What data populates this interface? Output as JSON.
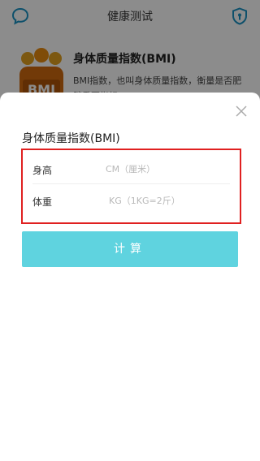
{
  "header": {
    "title": "健康测试",
    "left_icon": "chat-bubble-icon",
    "right_icon": "shield-icon",
    "accent": "#1a93c4"
  },
  "background_card": {
    "title": "身体质量指数(BMI)",
    "description": "BMI指数，也叫身体质量指数，衡量是否肥胖重要指标",
    "logo_text": "BMI"
  },
  "sheet": {
    "title": "身体质量指数(BMI)",
    "close_icon": "close-icon",
    "fields": [
      {
        "label": "身高",
        "value": "",
        "placeholder": "CM（厘米）"
      },
      {
        "label": "体重",
        "value": "",
        "placeholder": "KG（1KG=2斤）"
      }
    ],
    "calculate_label": "计算",
    "button_color": "#5fd3df",
    "highlight_color": "#e02020"
  }
}
